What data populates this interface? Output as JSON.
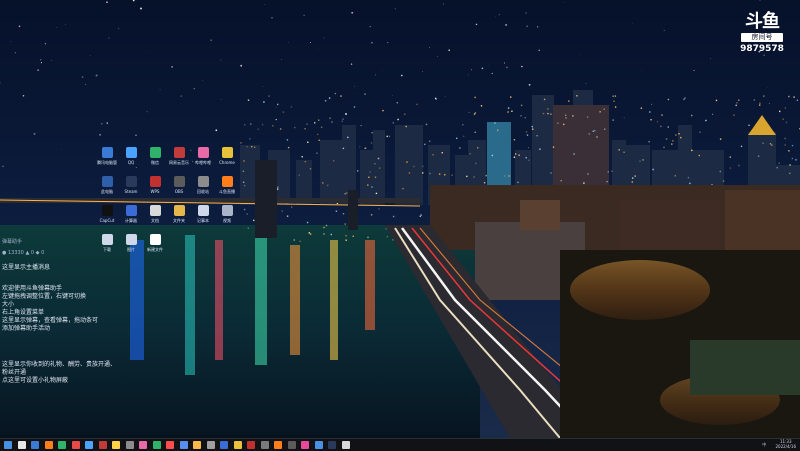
{
  "watermark": {
    "logo": "斗鱼",
    "sub": "房间号",
    "room_number": "9879578"
  },
  "desktop_icons": [
    {
      "label": "腾讯电脑管家",
      "color": "#3a7bd5",
      "icon": "shield-icon"
    },
    {
      "label": "QQ",
      "color": "#4aa3ff",
      "icon": "qq-icon"
    },
    {
      "label": "微信",
      "color": "#2fb36b",
      "icon": "chat-icon"
    },
    {
      "label": "网易云音乐",
      "color": "#c23b3b",
      "icon": "music-icon"
    },
    {
      "label": "哔哩哔哩",
      "color": "#e86aa6",
      "icon": "video-icon"
    },
    {
      "label": "Chrome",
      "color": "#e8c23b",
      "icon": "browser-icon"
    },
    {
      "label": "此电脑",
      "color": "#2f5fa8",
      "icon": "computer-icon"
    },
    {
      "label": "Steam",
      "color": "#2a3a5a",
      "icon": "game-icon"
    },
    {
      "label": "WPS",
      "color": "#c33030",
      "icon": "office-icon"
    },
    {
      "label": "OBS",
      "color": "#5b5b5b",
      "icon": "record-icon"
    },
    {
      "label": "回收站",
      "color": "#8c8c8c",
      "icon": "trash-icon"
    },
    {
      "label": "斗鱼直播",
      "color": "#ff7d1a",
      "icon": "live-icon"
    },
    {
      "label": "CapCut",
      "color": "#111111",
      "icon": "edit-icon"
    },
    {
      "label": "计算器",
      "color": "#3b6bd6",
      "icon": "calc-icon"
    },
    {
      "label": "文档",
      "color": "#d9d9d9",
      "icon": "doc-icon"
    },
    {
      "label": "文件夹",
      "color": "#e6b84a",
      "icon": "folder-icon"
    },
    {
      "label": "记事本",
      "color": "#cfd8e8",
      "icon": "notepad-icon"
    },
    {
      "label": "视频",
      "color": "#aab6c8",
      "icon": "file-icon"
    },
    {
      "label": "下载",
      "color": "#cfd8e8",
      "icon": "file-icon"
    },
    {
      "label": "图片",
      "color": "#cfd8e8",
      "icon": "image-icon"
    },
    {
      "label": "新建文件",
      "color": "#ffffff",
      "icon": "file-icon"
    }
  ],
  "side_panel": {
    "top_label": "弹幕助手",
    "row_label": "●  13330        ▲ 0    ◆ 0",
    "line1": "这里显示主播消息",
    "welcome_lines": [
      "欢迎使用斗鱼弹幕助手",
      "左键拖拽调整位置，右键可切换",
      "大小",
      "右上角设置菜单",
      "这里显示弹幕，查看弹幕，拖动条可",
      "添加弹幕助手活动"
    ],
    "gift_lines": [
      "这里显示你收到的礼物、酬劳、贵族开通、",
      "粉丝开通",
      "点这里可设置小礼物屏蔽"
    ]
  },
  "tray": {
    "input": "中",
    "time": "11:33",
    "date": "2022/4/16"
  },
  "taskbar_colors": [
    "#4a90e2",
    "#e8e8e8",
    "#3a7bd5",
    "#ff7d1a",
    "#2fb36b",
    "#e84a4a",
    "#4aa3ff",
    "#c23b3b",
    "#ffd24a",
    "#8c8c8c",
    "#e86aa6",
    "#2fb36b",
    "#ff4d4d",
    "#5b8def",
    "#ffb84a",
    "#a0a0a0",
    "#3b6bd6",
    "#e8c23b",
    "#c33030",
    "#7a7a7a",
    "#ff7d1a",
    "#5b5b5b",
    "#e84a9a",
    "#4a90e2",
    "#2a3a5a",
    "#d9d9d9"
  ]
}
